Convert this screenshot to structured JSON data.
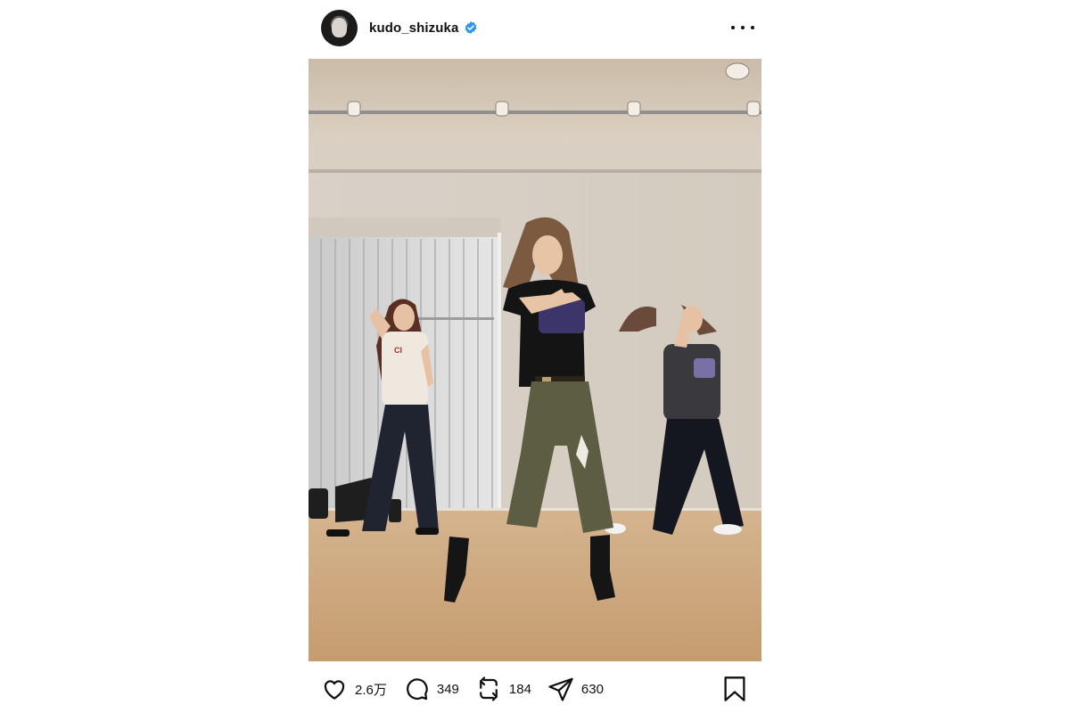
{
  "header": {
    "username": "kudo_shizuka",
    "verified_icon": "verified-badge-icon",
    "more_icon": "more-options-icon"
  },
  "media": {
    "kind": "photo",
    "accent_colors": {
      "floor": "#c6a17a",
      "wall": "#d8cfc4",
      "verified": "#2e95f3"
    }
  },
  "actions": {
    "like_count": "2.6万",
    "comment_count": "349",
    "repost_count": "184",
    "share_count": "630",
    "icons": [
      "heart-icon",
      "comment-icon",
      "repost-icon",
      "share-icon",
      "bookmark-icon"
    ]
  }
}
